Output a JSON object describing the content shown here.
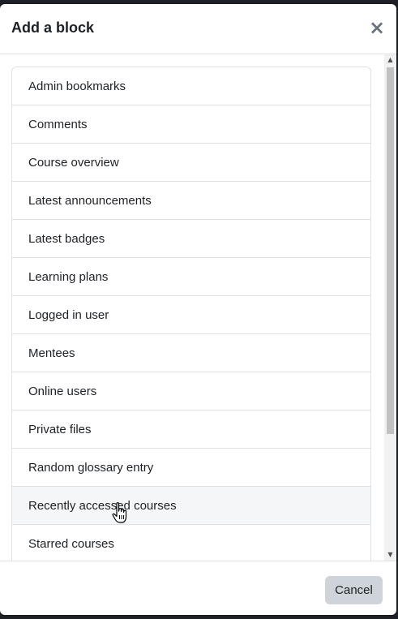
{
  "modal": {
    "title": "Add a block",
    "close_symbol": "×",
    "cancel_label": "Cancel"
  },
  "blocks": [
    {
      "label": "Admin bookmarks"
    },
    {
      "label": "Comments"
    },
    {
      "label": "Course overview"
    },
    {
      "label": "Latest announcements"
    },
    {
      "label": "Latest badges"
    },
    {
      "label": "Learning plans"
    },
    {
      "label": "Logged in user"
    },
    {
      "label": "Mentees"
    },
    {
      "label": "Online users"
    },
    {
      "label": "Private files"
    },
    {
      "label": "Random glossary entry"
    },
    {
      "label": "Recently accessed courses"
    },
    {
      "label": "Starred courses"
    },
    {
      "label": ""
    }
  ],
  "hovered_block": "Recently accessed courses",
  "icons": {
    "close": "close-icon",
    "cursor": "hand-pointer-icon",
    "scroll_up": "scroll-up-arrow-icon",
    "scroll_down": "scroll-down-arrow-icon"
  }
}
